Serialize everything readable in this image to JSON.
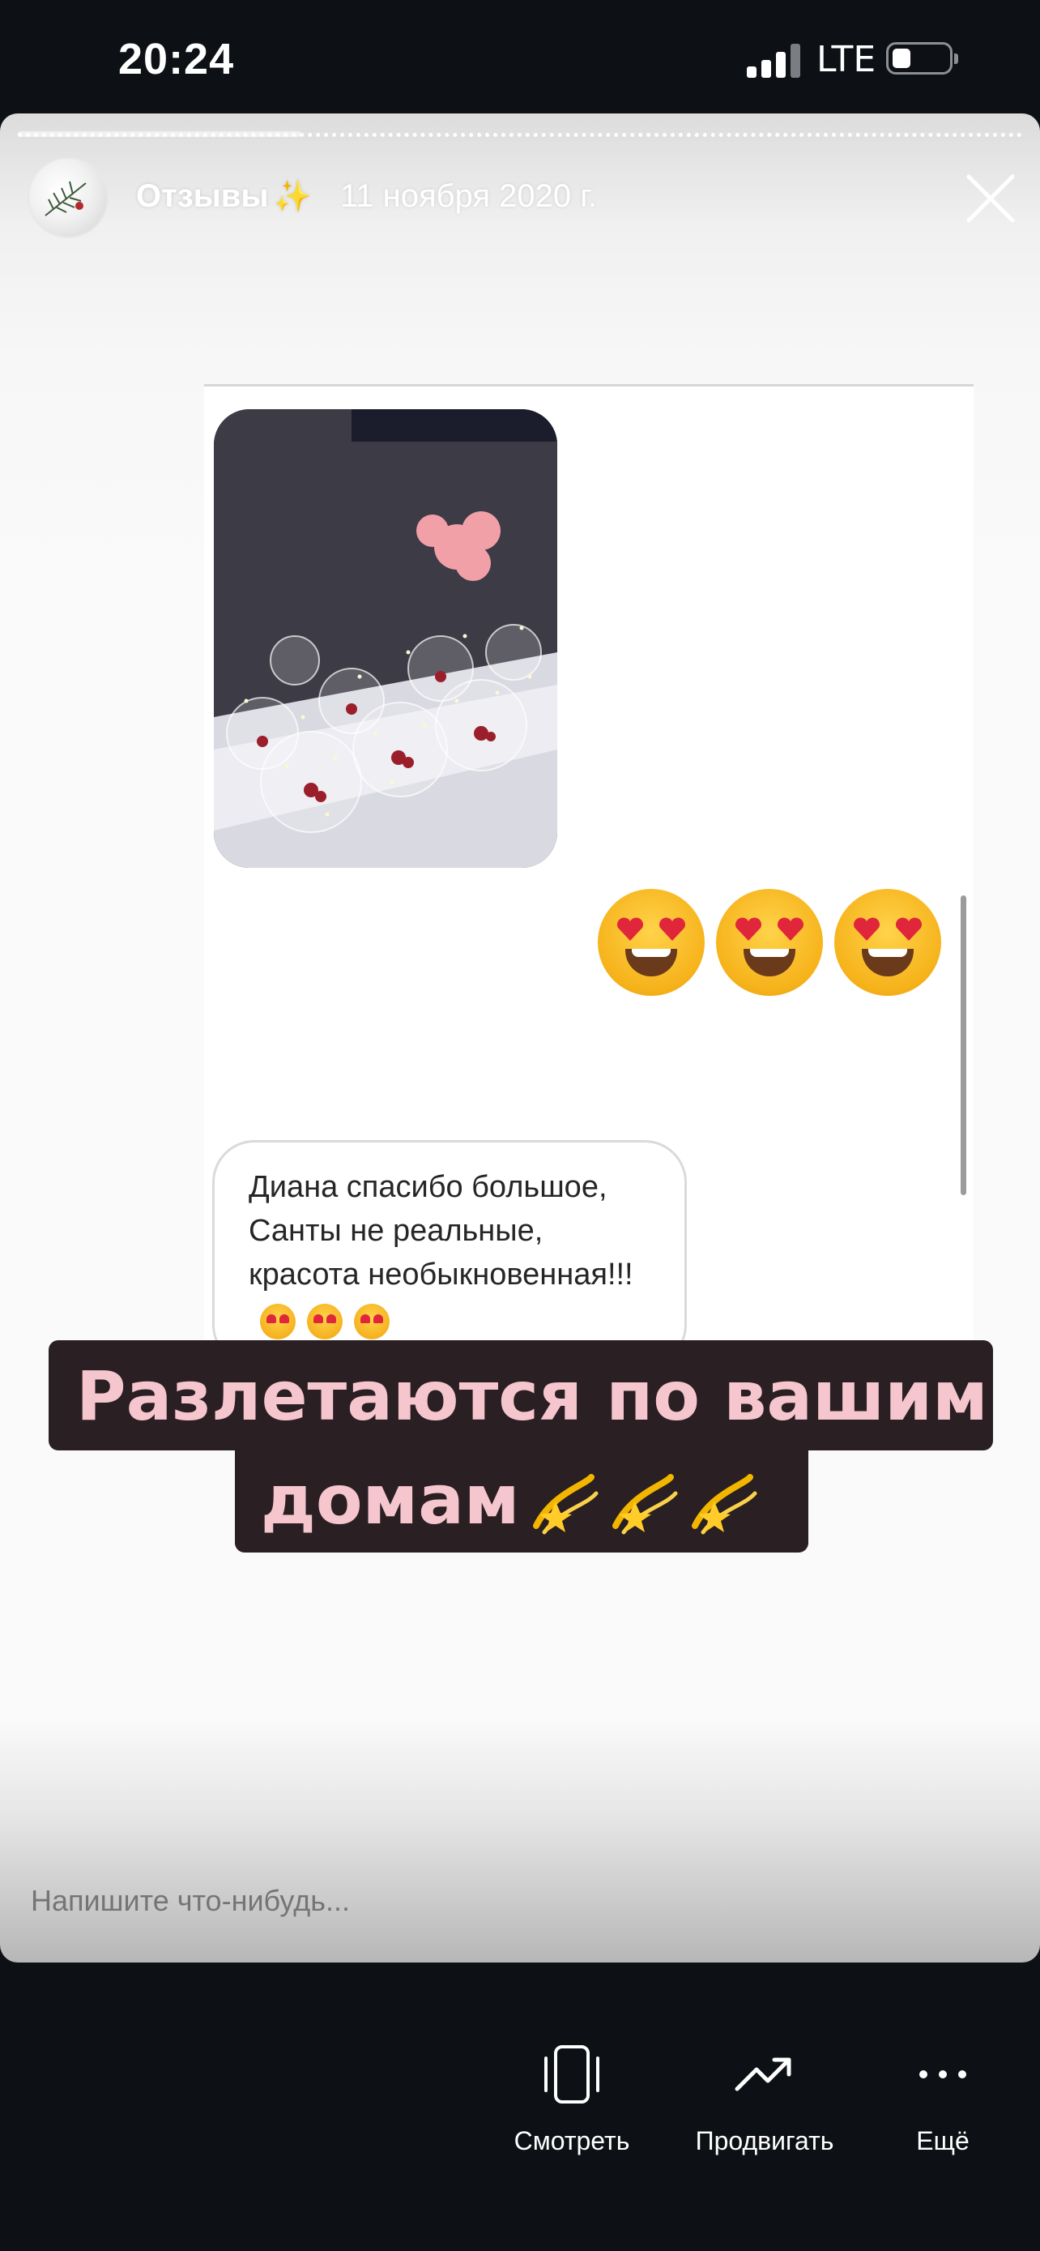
{
  "status_bar": {
    "time": "20:24",
    "network": "LTE"
  },
  "story": {
    "title": "Отзывы",
    "title_emoji": "✨",
    "date": "11 ноября 2020 г.",
    "embedded_chat": {
      "reply_text": "Диана спасибо большое, Санты не реальные, красота необыкновенная!!!",
      "reaction_emojis": [
        "😍",
        "😍",
        "😍"
      ]
    },
    "caption_line1": "Разлетаются по вашим",
    "caption_line2": "домам",
    "caption_emojis": [
      "💫",
      "💫",
      "💫"
    ],
    "reply_placeholder": "Напишите что-нибудь..."
  },
  "actions": {
    "view_label": "Смотреть",
    "promote_label": "Продвигать",
    "more_label": "Ещё"
  },
  "colors": {
    "caption_bg": "#2a1f22",
    "caption_text": "#f6c6cf",
    "app_bg": "#0d1014"
  },
  "icons": [
    "signal-icon",
    "battery-icon",
    "close-icon",
    "view-device-icon",
    "promote-trend-icon",
    "more-dots-icon"
  ]
}
